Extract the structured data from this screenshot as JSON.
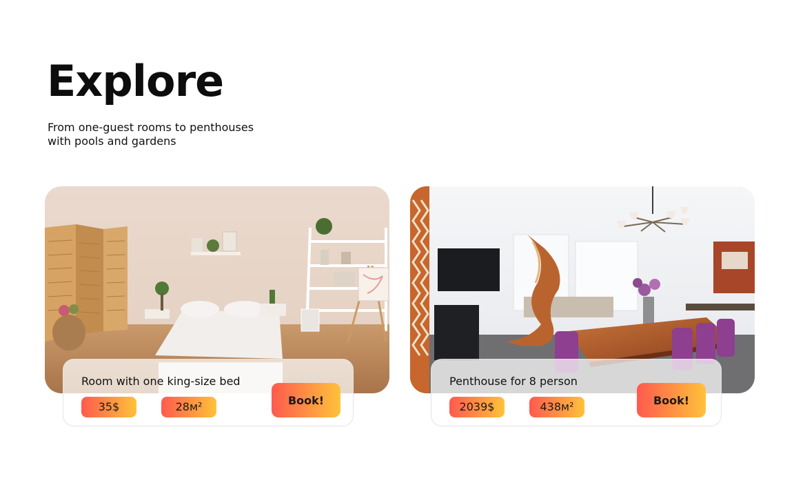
{
  "header": {
    "title": "Explore",
    "subtitle": "From one-guest rooms to penthouses with pools and gardens"
  },
  "cards": [
    {
      "name": "Room with one king-size bed",
      "price": "35$",
      "area": "28м²",
      "book_label": "Book!"
    },
    {
      "name": "Penthouse for 8 person",
      "price": "2039$",
      "area": "438м²",
      "book_label": "Book!"
    }
  ],
  "colors": {
    "accent_start": "#ff5a4e",
    "accent_end": "#ffc23a",
    "text": "#111111",
    "background": "#ffffff"
  }
}
